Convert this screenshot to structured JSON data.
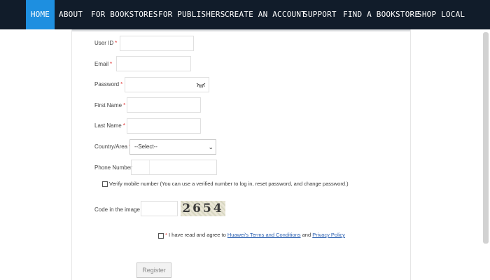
{
  "nav": {
    "items": [
      {
        "label": "HOME",
        "active": true
      },
      {
        "label": "ABOUT"
      },
      {
        "label": "FOR BOOKSTORES"
      },
      {
        "label": "FOR PUBLISHERS"
      },
      {
        "label": "CREATE AN ACCOUNT"
      },
      {
        "label": "SUPPORT"
      },
      {
        "label": "FIND A BOOKSTORE"
      },
      {
        "label": "SHOP LOCAL"
      }
    ]
  },
  "form": {
    "user_id_label": "User ID",
    "email_label": "Email",
    "password_label": "Password",
    "first_name_label": "First Name",
    "last_name_label": "Last Name",
    "country_label": "Country/Area",
    "country_selected": "--Select--",
    "phone_label": "Phone Number",
    "verify_text": "Verify mobile number (You can use a verified number to log in, reset password, and change password.)",
    "code_label": "Code in the image",
    "captcha_text": "2654",
    "agree_prefix": "I have read and agree to",
    "terms_link": "Huawei's Terms and Conditions",
    "agree_and": "and",
    "privacy_link": "Privacy Policy",
    "required_mark": "*",
    "register_label": "Register"
  },
  "colors": {
    "nav_bg": "#111c2a",
    "nav_active": "#1e8fe0",
    "required": "#e03030",
    "link": "#2a5fb0"
  }
}
